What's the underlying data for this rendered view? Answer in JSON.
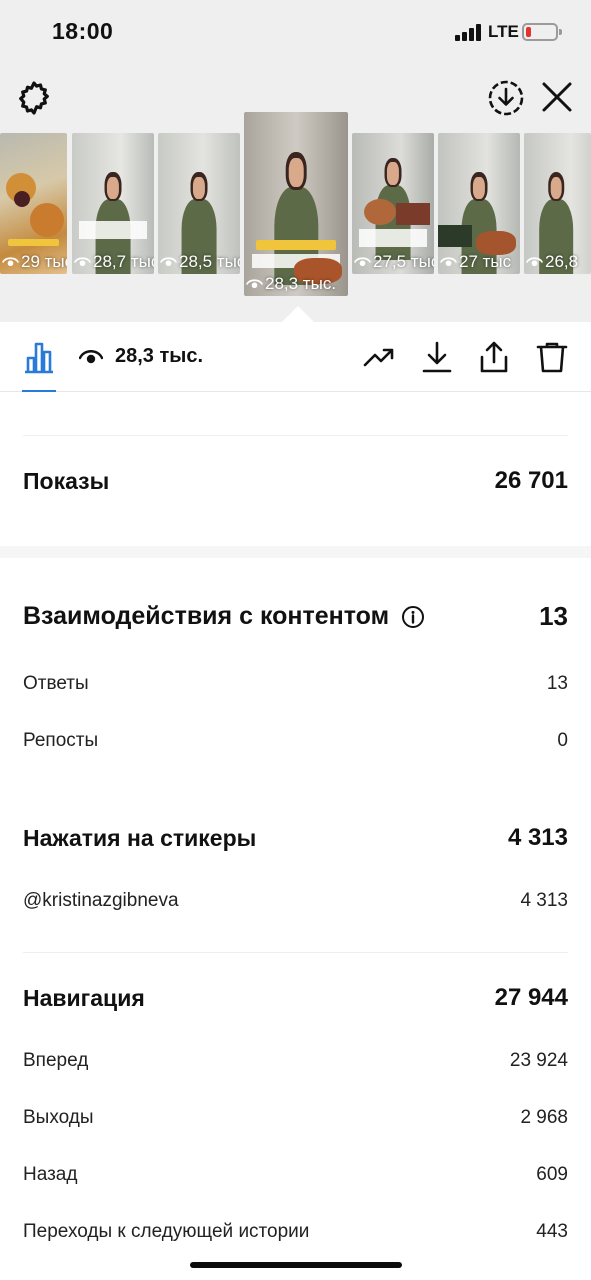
{
  "status_bar": {
    "time": "18:00",
    "network": "LTE"
  },
  "top_bar": {
    "settings_icon": "gear-icon",
    "download_all_icon": "circle-download-icon",
    "close_icon": "close-icon"
  },
  "stories": [
    {
      "views": "29 тыс"
    },
    {
      "views": "28,7 тыс"
    },
    {
      "views": "28,5 тыс"
    },
    {
      "views": "28,3 тыс.",
      "selected": true
    },
    {
      "views": "27,5 тыс"
    },
    {
      "views": "27 тыс"
    },
    {
      "views": "26,8"
    }
  ],
  "action_bar": {
    "views_total": "28,3 тыс.",
    "accent": "#2a7ad8",
    "icons": [
      "trending-icon",
      "download-icon",
      "share-icon",
      "trash-icon"
    ]
  },
  "metrics": {
    "impressions": {
      "label": "Показы",
      "value": "26 701"
    },
    "interactions": {
      "label": "Взаимодействия с контентом",
      "value": "13",
      "rows": [
        {
          "label": "Ответы",
          "value": "13"
        },
        {
          "label": "Репосты",
          "value": "0"
        }
      ]
    },
    "sticker_taps": {
      "label": "Нажатия на стикеры",
      "value": "4 313",
      "rows": [
        {
          "label": "@kristinazgibneva",
          "value": "4 313"
        }
      ]
    },
    "navigation": {
      "label": "Навигация",
      "value": "27 944",
      "rows": [
        {
          "label": "Вперед",
          "value": "23 924"
        },
        {
          "label": "Выходы",
          "value": "2 968"
        },
        {
          "label": "Назад",
          "value": "609"
        },
        {
          "label": "Переходы к следующей истории",
          "value": "443"
        }
      ]
    }
  }
}
